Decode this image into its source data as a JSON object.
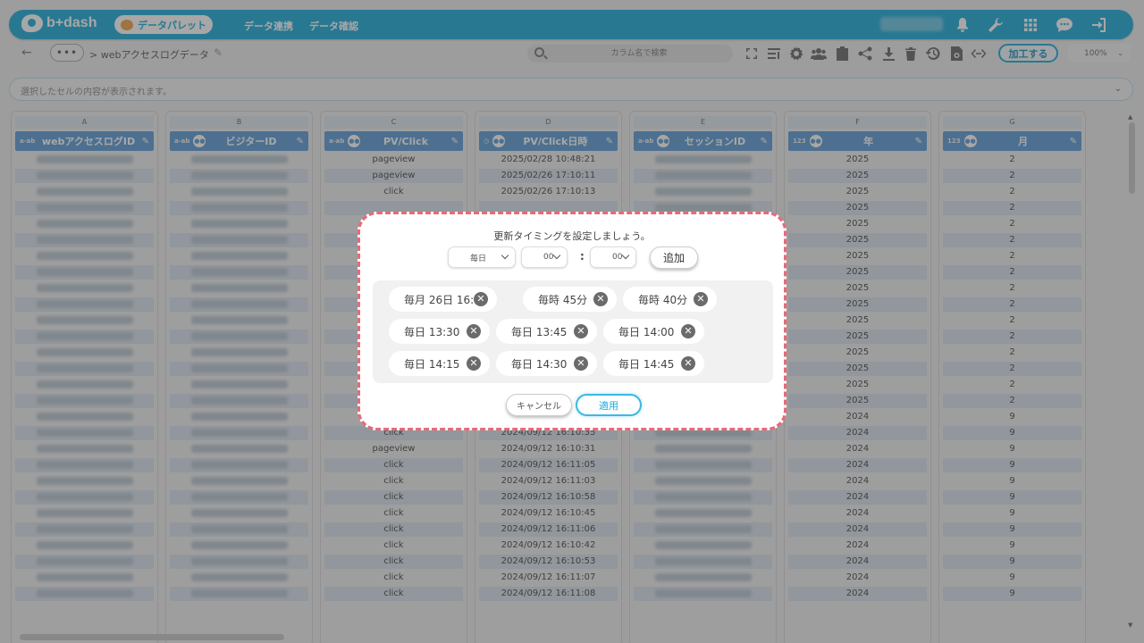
{
  "app": {
    "logo": "b+dash",
    "palette_label": "データパレット",
    "nav": [
      "データ連携",
      "データ確認"
    ]
  },
  "toolbar": {
    "breadcrumb": "> webアクセスログデータ",
    "search_placeholder": "カラム名で検索",
    "process_label": "加工する",
    "zoom": "100%"
  },
  "cell_info": "選択したセルの内容が表示されます。",
  "columns": [
    {
      "letter": "A",
      "name": "webアクセスログID",
      "type": "a-abc"
    },
    {
      "letter": "B",
      "name": "ビジターID",
      "type": "a-abc"
    },
    {
      "letter": "C",
      "name": "PV/Click",
      "type": "a-abc"
    },
    {
      "letter": "D",
      "name": "PV/Click日時",
      "type": "datetime"
    },
    {
      "letter": "E",
      "name": "セッションID",
      "type": "a-abc"
    },
    {
      "letter": "F",
      "name": "年",
      "type": "123"
    },
    {
      "letter": "G",
      "name": "月",
      "type": "123"
    }
  ],
  "rows": [
    {
      "c": "pageview",
      "d": "2025/02/28 10:48:21",
      "f": "2025",
      "g": "2"
    },
    {
      "c": "pageview",
      "d": "2025/02/26 17:10:11",
      "f": "2025",
      "g": "2"
    },
    {
      "c": "click",
      "d": "2025/02/26 17:10:13",
      "f": "2025",
      "g": "2"
    },
    {
      "c": "",
      "d": "",
      "f": "2025",
      "g": "2"
    },
    {
      "c": "",
      "d": "",
      "f": "2025",
      "g": "2"
    },
    {
      "c": "",
      "d": "",
      "f": "2025",
      "g": "2"
    },
    {
      "c": "",
      "d": "",
      "f": "2025",
      "g": "2"
    },
    {
      "c": "",
      "d": "",
      "f": "2025",
      "g": "2"
    },
    {
      "c": "",
      "d": "",
      "f": "2025",
      "g": "2"
    },
    {
      "c": "",
      "d": "",
      "f": "2025",
      "g": "2"
    },
    {
      "c": "",
      "d": "",
      "f": "2025",
      "g": "2"
    },
    {
      "c": "",
      "d": "",
      "f": "2025",
      "g": "2"
    },
    {
      "c": "",
      "d": "",
      "f": "2025",
      "g": "2"
    },
    {
      "c": "",
      "d": "",
      "f": "2025",
      "g": "2"
    },
    {
      "c": "",
      "d": "",
      "f": "2025",
      "g": "2"
    },
    {
      "c": "",
      "d": "",
      "f": "2025",
      "g": "2"
    },
    {
      "c": "click",
      "d": "",
      "f": "2024",
      "g": "9"
    },
    {
      "c": "click",
      "d": "2024/09/12 16:10:35",
      "f": "2024",
      "g": "9"
    },
    {
      "c": "pageview",
      "d": "2024/09/12 16:10:31",
      "f": "2024",
      "g": "9"
    },
    {
      "c": "click",
      "d": "2024/09/12 16:11:05",
      "f": "2024",
      "g": "9"
    },
    {
      "c": "click",
      "d": "2024/09/12 16:11:03",
      "f": "2024",
      "g": "9"
    },
    {
      "c": "click",
      "d": "2024/09/12 16:10:58",
      "f": "2024",
      "g": "9"
    },
    {
      "c": "click",
      "d": "2024/09/12 16:10:45",
      "f": "2024",
      "g": "9"
    },
    {
      "c": "click",
      "d": "2024/09/12 16:11:06",
      "f": "2024",
      "g": "9"
    },
    {
      "c": "click",
      "d": "2024/09/12 16:10:42",
      "f": "2024",
      "g": "9"
    },
    {
      "c": "click",
      "d": "2024/09/12 16:10:53",
      "f": "2024",
      "g": "9"
    },
    {
      "c": "click",
      "d": "2024/09/12 16:11:07",
      "f": "2024",
      "g": "9"
    },
    {
      "c": "click",
      "d": "2024/09/12 16:11:08",
      "f": "2024",
      "g": "9"
    }
  ],
  "dialog": {
    "title": "更新タイミングを設定しましょう。",
    "freq": "毎日",
    "hour": "00",
    "colon": ":",
    "minute": "00",
    "add_label": "追加",
    "chips": [
      "毎月 26日 16:30",
      "毎時 45分",
      "毎時 40分",
      "毎日 13:30",
      "毎日 13:45",
      "毎日 14:00",
      "毎日 14:15",
      "毎日 14:30",
      "毎日 14:45"
    ],
    "remove_glyph": "✕",
    "cancel_label": "キャンセル",
    "apply_label": "適用"
  },
  "colors": {
    "brand": "#1aa9d9",
    "header": "#5b9bd5",
    "highlight": "#e8697a"
  }
}
